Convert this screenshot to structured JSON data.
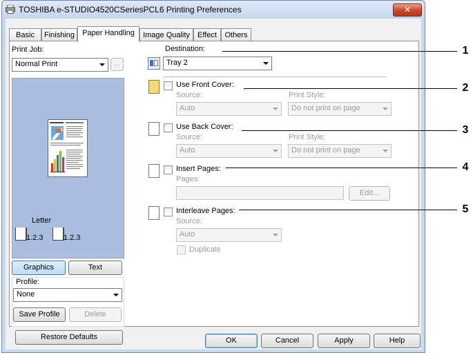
{
  "window": {
    "title": "TOSHIBA e-STUDIO4520CSeriesPCL6 Printing Preferences",
    "close_symbol": "✕"
  },
  "tabs": [
    {
      "label": "Basic"
    },
    {
      "label": "Finishing"
    },
    {
      "label": "Paper Handling",
      "active": true
    },
    {
      "label": "Image Quality"
    },
    {
      "label": "Effect"
    },
    {
      "label": "Others"
    }
  ],
  "left": {
    "print_job_label": "Print Job:",
    "print_job_value": "Normal Print",
    "print_job_more": "...",
    "paper_label": "Letter",
    "staple_1": "1.2.3",
    "staple_2": "1.2.3",
    "graphics_btn": "Graphics",
    "text_btn": "Text",
    "profile_label": "Profile:",
    "profile_value": "None",
    "save_profile_btn": "Save Profile",
    "delete_btn": "Delete",
    "restore_btn": "Restore Defaults"
  },
  "right": {
    "destination_label": "Destination:",
    "destination_value": "Tray 2",
    "front_cover": {
      "label": "Use Front Cover:",
      "source_label": "Source:",
      "source_value": "Auto",
      "style_label": "Print Style:",
      "style_value": "Do not print on page"
    },
    "back_cover": {
      "label": "Use Back Cover:",
      "source_label": "Source:",
      "source_value": "Auto",
      "style_label": "Print Style:",
      "style_value": "Do not print on page"
    },
    "insert_pages": {
      "label": "Insert Pages:",
      "pages_label": "Pages:",
      "edit_btn": "Edit..."
    },
    "interleave": {
      "label": "Interleave Pages:",
      "source_label": "Source:",
      "source_value": "Auto",
      "duplicate_label": "Duplicate"
    }
  },
  "footer": {
    "ok": "OK",
    "cancel": "Cancel",
    "apply": "Apply",
    "help": "Help"
  },
  "callouts": [
    "1",
    "2",
    "3",
    "4",
    "5"
  ],
  "colors": {
    "preview_bg": "#a9bddf",
    "selected_btn": "#cde1f7",
    "close_btn": "#c4462c"
  }
}
